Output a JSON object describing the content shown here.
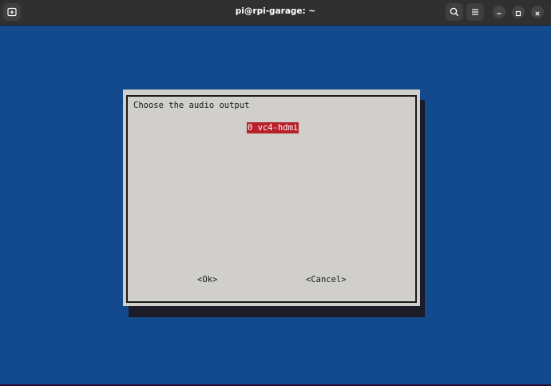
{
  "window": {
    "title": "pi@rpi-garage: ~",
    "icons": {
      "new_tab": "new-tab-icon",
      "search": "search-icon",
      "menu": "hamburger-menu-icon",
      "minimize": "minimize-icon",
      "maximize": "maximize-icon",
      "close": "close-icon"
    }
  },
  "colors": {
    "terminal_background": "#134a8e",
    "dialog_background": "#d0cfcb",
    "selection_background": "#b8202a",
    "selection_text": "#ffffff"
  },
  "dialog": {
    "prompt": "Choose the audio output",
    "options": [
      {
        "label": "0 vc4-hdmi",
        "selected": true
      }
    ],
    "ok_label": "<Ok>",
    "cancel_label": "<Cancel>"
  }
}
